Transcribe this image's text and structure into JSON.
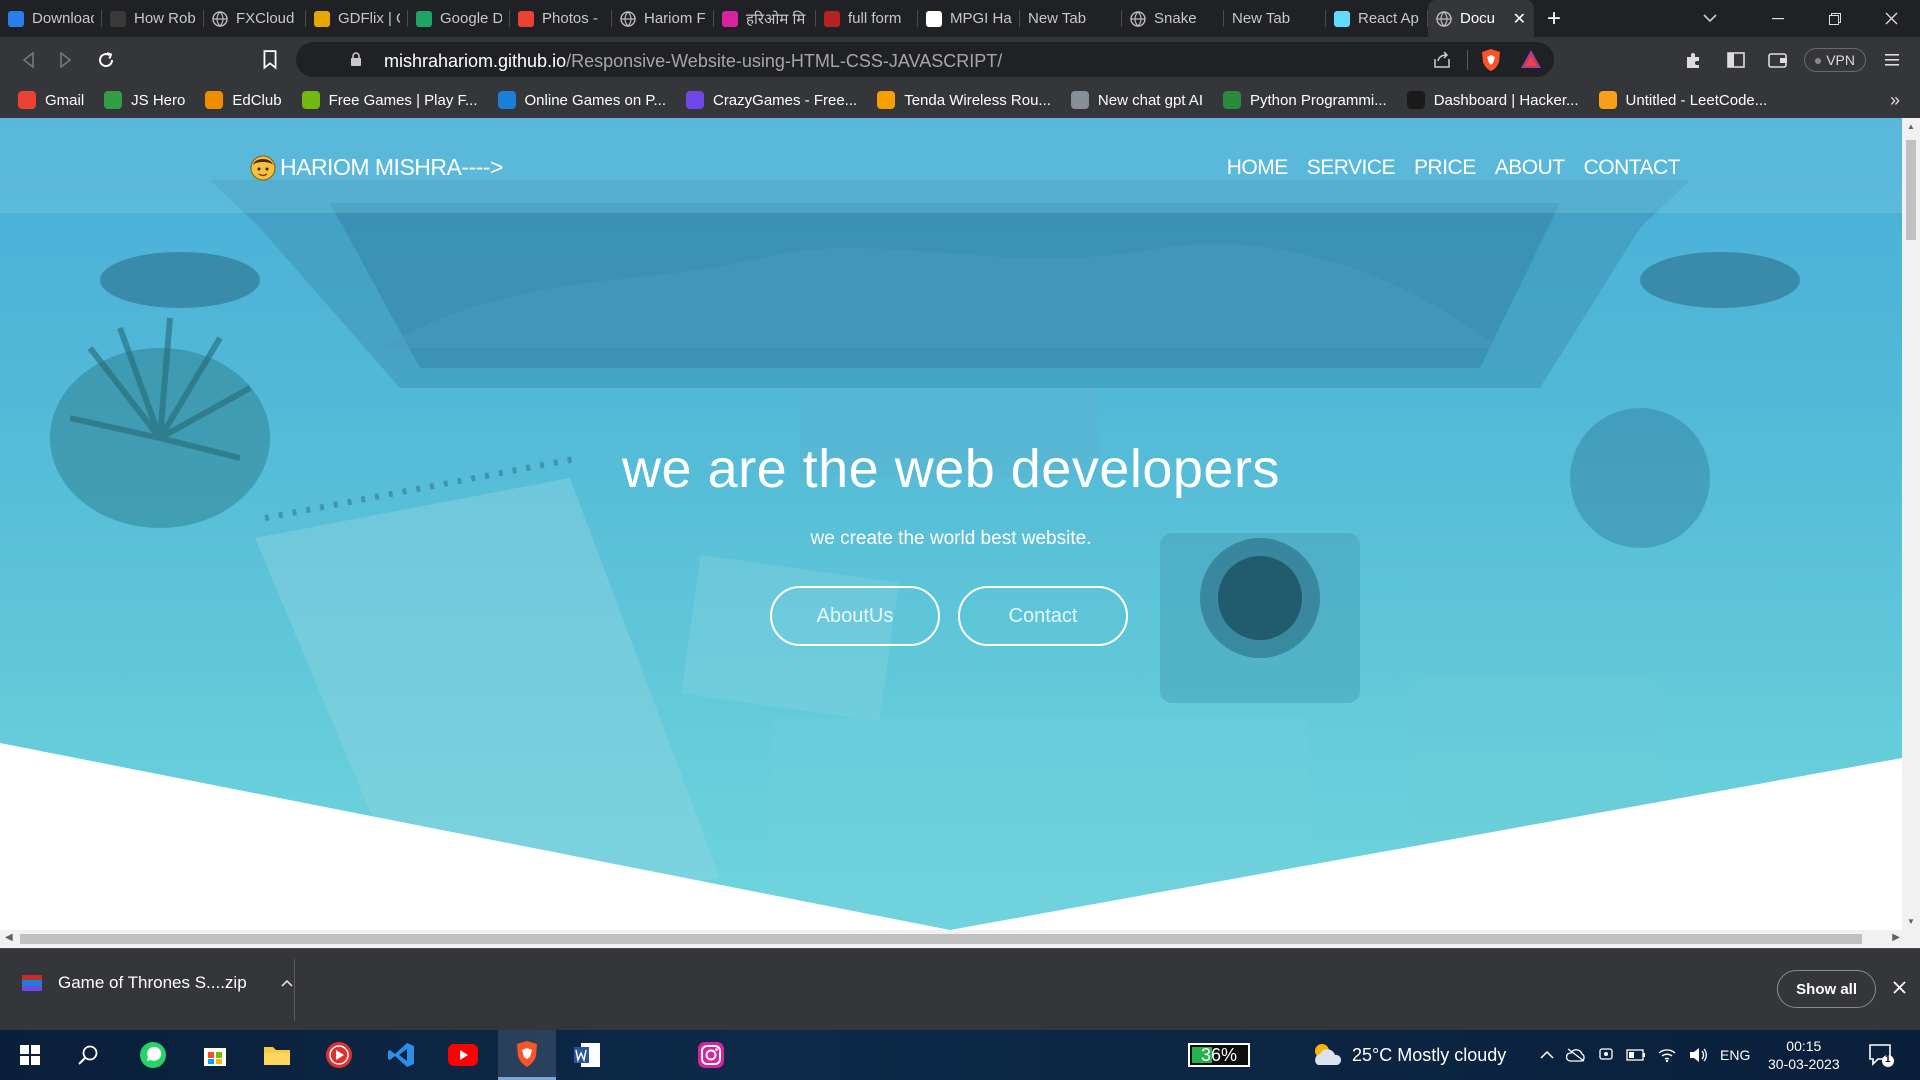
{
  "tabs": [
    {
      "title": "Download",
      "icon": "bing-icon",
      "color": "#2b7de9"
    },
    {
      "title": "How Rob",
      "icon": "page-icon",
      "color": "#3a3a3a"
    },
    {
      "title": "FXCloud",
      "icon": "globe-icon",
      "color": "#5a5a5a"
    },
    {
      "title": "GDFlix | C",
      "icon": "gdflix-icon",
      "color": "#e8a600"
    },
    {
      "title": "Google D",
      "icon": "google-drive-icon",
      "color": "#1fa463"
    },
    {
      "title": "Photos -",
      "icon": "google-photos-icon",
      "color": "#ea4335"
    },
    {
      "title": "Hariom F",
      "icon": "globe-icon",
      "color": "#5a5a5a"
    },
    {
      "title": "हरिओम मि",
      "icon": "instagram-icon",
      "color": "#d6249f"
    },
    {
      "title": "full form",
      "icon": "shield-icon",
      "color": "#b32121"
    },
    {
      "title": "MPGI Ha",
      "icon": "mpgi-icon",
      "color": "#ffffff"
    },
    {
      "title": "New Tab",
      "icon": "",
      "color": ""
    },
    {
      "title": "Snake",
      "icon": "globe-icon",
      "color": "#5a5a5a"
    },
    {
      "title": "New Tab",
      "icon": "",
      "color": ""
    },
    {
      "title": "React Ap",
      "icon": "react-icon",
      "color": "#61dafb"
    },
    {
      "title": "Docu",
      "icon": "globe-icon",
      "color": "#5a5a5a"
    }
  ],
  "address": {
    "domain": "mishrahariom.github.io",
    "path": "/Responsive-Website-using-HTML-CSS-JAVASCRIPT/"
  },
  "toolbar": {
    "vpn_label": "VPN"
  },
  "bookmarks": [
    {
      "label": "Gmail",
      "icon": "gmail-icon",
      "color": "#ea4335"
    },
    {
      "label": "JS Hero",
      "icon": "js-hero-icon",
      "color": "#2f9e44"
    },
    {
      "label": "EdClub",
      "icon": "edclub-icon",
      "color": "#f08c00"
    },
    {
      "label": "Free Games | Play F...",
      "icon": "free-games-icon",
      "color": "#74b816"
    },
    {
      "label": "Online Games on P...",
      "icon": "poki-icon",
      "color": "#1c7ed6"
    },
    {
      "label": "CrazyGames - Free...",
      "icon": "crazygames-icon",
      "color": "#7048e8"
    },
    {
      "label": "Tenda Wireless Rou...",
      "icon": "tenda-icon",
      "color": "#f59f00"
    },
    {
      "label": "New chat gpt AI",
      "icon": "chatgpt-icon",
      "color": "#868e96"
    },
    {
      "label": "Python Programmi...",
      "icon": "python-icon",
      "color": "#2b8a3e"
    },
    {
      "label": "Dashboard | Hacker...",
      "icon": "hackerrank-icon",
      "color": "#1a1a1a"
    },
    {
      "label": "Untitled - LeetCode...",
      "icon": "leetcode-icon",
      "color": "#f89f1b"
    }
  ],
  "site": {
    "logo_text": "HARIOM MISHRA---->",
    "nav": [
      "HOME",
      "SERVICE",
      "PRICE",
      "ABOUT",
      "CONTACT"
    ],
    "headline": "we are the web developers",
    "subheadline": "we create the world best website.",
    "btn_about": "AboutUs",
    "btn_contact": "Contact"
  },
  "download": {
    "filename": "Game of Thrones S....zip",
    "show_all": "Show all"
  },
  "taskbar": {
    "battery": "36%",
    "weather": "25°C  Mostly cloudy",
    "language": "ENG",
    "time": "00:15",
    "date": "30-03-2023",
    "notifications": "1"
  },
  "colors": {
    "hero_top": "#4aaed8",
    "hero_bottom": "#6ed6dd",
    "chrome_dark": "#202124",
    "chrome_mid": "#35363a"
  }
}
